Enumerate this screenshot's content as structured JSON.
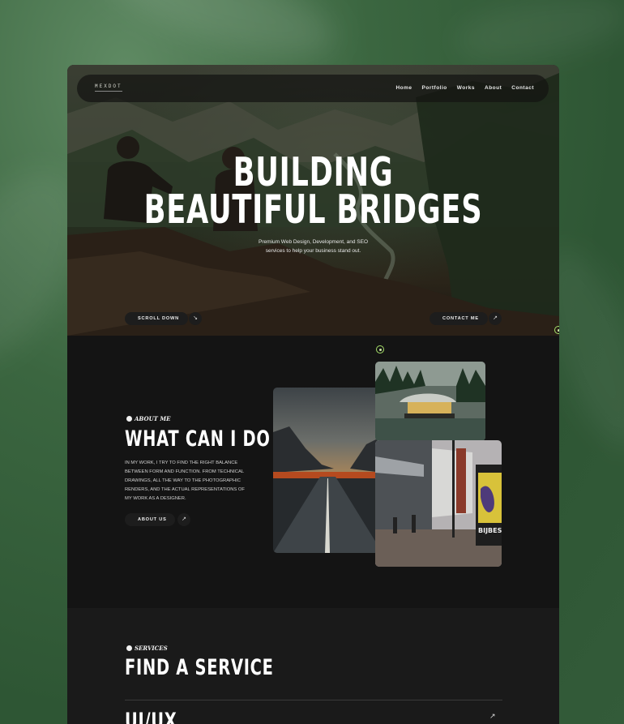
{
  "brand": {
    "logo": "MEXDOT"
  },
  "nav": {
    "items": [
      "Home",
      "Portfolio",
      "Works",
      "About",
      "Contact"
    ]
  },
  "hero": {
    "title_line1": "BUILDING",
    "title_line2": "BEAUTIFUL BRIDGES",
    "subtitle_line1": "Premium Web Design, Development, and SEO",
    "subtitle_line2": "services to help your business stand out.",
    "scroll_label": "SCROLL DOWN",
    "contact_label": "CONTACT ME",
    "arrow_icon": "arrow-up-right-icon"
  },
  "about": {
    "eyebrow": "ABOUT ME",
    "title": "WHAT CAN I DO",
    "paragraph": "IN MY WORK, I TRY TO FIND THE RIGHT BALANCE BETWEEN FORM AND FUNCTION. FROM TECHNICAL DRAWINGS, ALL THE WAY TO THE PHOTOGRAPHIC RENDERS, AND THE ACTUAL REPRESENTATIONS OF MY WORK AS A DESIGNER.",
    "button_label": "ABOUT US",
    "sign_text": "BIJBESIU"
  },
  "services": {
    "eyebrow": "SERVICES",
    "title": "FIND A SERVICE",
    "first_item": "UI/UX"
  },
  "colors": {
    "accent": "#a7e06a",
    "background": "#2e5634",
    "panel": "#141414"
  }
}
